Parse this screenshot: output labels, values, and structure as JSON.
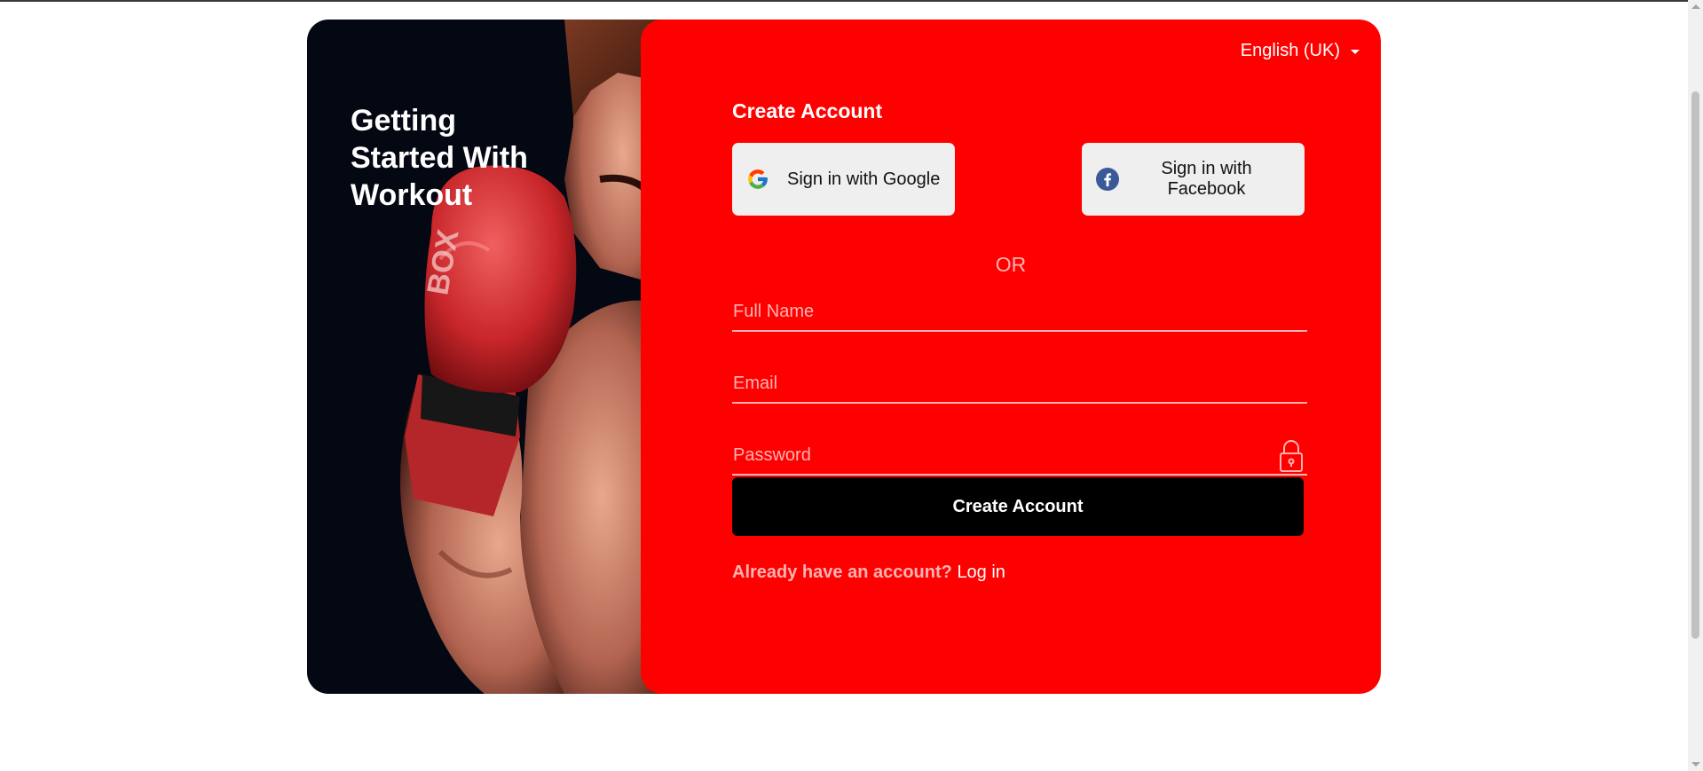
{
  "hero": {
    "title_line1": "Getting",
    "title_line2": "Started With",
    "title_line3": "Workout"
  },
  "language": {
    "selected": "English (UK)"
  },
  "form": {
    "title": "Create Account",
    "google_label": "Sign in with Google",
    "facebook_line1": "Sign in with",
    "facebook_line2": "Facebook",
    "divider": "OR",
    "full_name_placeholder": "Full Name",
    "email_placeholder": "Email",
    "password_placeholder": "Password",
    "submit_label": "Create Account",
    "login_question": "Already have an account?",
    "login_link": "Log in"
  },
  "icons": [
    "google-icon",
    "facebook-icon",
    "lock-icon",
    "chevron-down-icon"
  ],
  "colors": {
    "panel": "#ff0000",
    "button": "#000000",
    "hero_background": "#030812",
    "social_button": "#efefef"
  }
}
